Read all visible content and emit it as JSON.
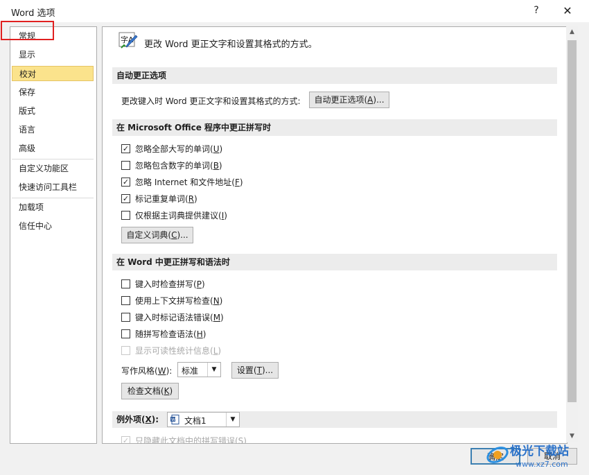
{
  "window": {
    "title": "Word 选项",
    "help": "?",
    "close": "✕"
  },
  "nav": {
    "items": [
      "常规",
      "显示",
      "校对",
      "保存",
      "版式",
      "语言",
      "高级",
      "自定义功能区",
      "快速访问工具栏",
      "加载项",
      "信任中心"
    ],
    "selected": "校对"
  },
  "header": {
    "icon_text": "字A",
    "text": "更改 Word 更正文字和设置其格式的方式。"
  },
  "autocorrect": {
    "section": "自动更正选项",
    "label": "更改键入时 Word 更正文字和设置其格式的方式:",
    "button_pre": "自动更正选项(",
    "button_key": "A",
    "button_post": ")..."
  },
  "office_spell": {
    "section": "在 Microsoft Office 程序中更正拼写时",
    "options": [
      {
        "pre": "忽略全部大写的单词(",
        "key": "U",
        "post": ")",
        "checked": true
      },
      {
        "pre": "忽略包含数字的单词(",
        "key": "B",
        "post": ")",
        "checked": false
      },
      {
        "pre": "忽略 Internet 和文件地址(",
        "key": "F",
        "post": ")",
        "checked": true
      },
      {
        "pre": "标记重复单词(",
        "key": "R",
        "post": ")",
        "checked": true
      },
      {
        "pre": "仅根据主词典提供建议(",
        "key": "I",
        "post": ")",
        "checked": false
      }
    ],
    "dict_button_pre": "自定义词典(",
    "dict_button_key": "C",
    "dict_button_post": ")..."
  },
  "word_spell": {
    "section": "在 Word 中更正拼写和语法时",
    "options": [
      {
        "pre": "键入时检查拼写(",
        "key": "P",
        "post": ")",
        "checked": false,
        "disabled": false
      },
      {
        "pre": "使用上下文拼写检查(",
        "key": "N",
        "post": ")",
        "checked": false,
        "disabled": false
      },
      {
        "pre": "键入时标记语法错误(",
        "key": "M",
        "post": ")",
        "checked": false,
        "disabled": false
      },
      {
        "pre": "随拼写检查语法(",
        "key": "H",
        "post": ")",
        "checked": false,
        "disabled": false
      },
      {
        "pre": "显示可读性统计信息(",
        "key": "L",
        "post": ")",
        "checked": false,
        "disabled": true
      }
    ],
    "style_label_pre": "写作风格(",
    "style_label_key": "W",
    "style_label_post": "):",
    "style_value": "标准",
    "settings_pre": "设置(",
    "settings_key": "T",
    "settings_post": ")...",
    "recheck_pre": "检查文档(",
    "recheck_key": "K",
    "recheck_post": ")"
  },
  "exceptions": {
    "section_pre": "例外项(",
    "section_key": "X",
    "section_post": "):",
    "doc_value": "文档1",
    "partial_option": "只隐藏此文档中的拼写错误(S)"
  },
  "footer": {
    "ok": "确定",
    "cancel": "取消"
  },
  "watermark": {
    "text": "极光下载站",
    "url": "www.xz7.com"
  },
  "colors": {
    "selected_bg": "#fbe38c",
    "section_bg": "#ececec",
    "highlight_box": "#e02020"
  }
}
